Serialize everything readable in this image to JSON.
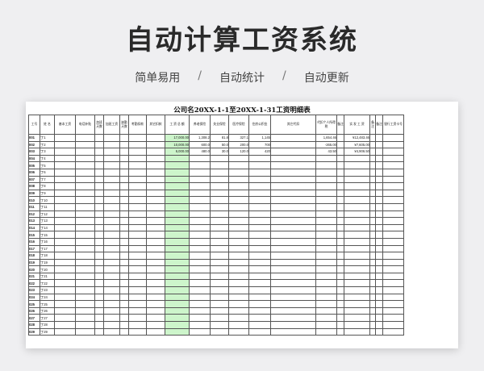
{
  "hero": {
    "title": "自动计算工资系统",
    "features": [
      "简单易用",
      "自动统计",
      "自动更新"
    ],
    "separator": "/"
  },
  "sheet": {
    "title": "公司名20XX-1-1至20XX-1-31工资明细表",
    "highlight_color": "#cdf5cb",
    "columns": [
      "工号",
      "姓 名",
      "基本工资",
      "电话补贴",
      "加班天数",
      "加班工资",
      "缺勤天数",
      "考勤扣款",
      "其它扣款",
      "工 资 总 额",
      "养老保险",
      "失业保险",
      "医疗保险",
      "住房公积金",
      "其它代扣",
      "代扣个人所得税",
      "备注",
      "实 发 工 资",
      "备注",
      "备注",
      "银行工资卡号"
    ],
    "rows": [
      [
        "001",
        "丁1",
        "",
        "",
        "",
        "",
        "",
        "",
        "",
        "17,000.00",
        "1,308.2",
        "81.8",
        "327.1",
        "1,145",
        "",
        "1,654.46",
        "",
        "¥12,483.46",
        "",
        "",
        ""
      ],
      [
        "002",
        "丁2",
        "",
        "",
        "",
        "",
        "",
        "",
        "",
        "10,000.00",
        "600.0",
        "50.0",
        "200.0",
        "700",
        "",
        "-265.00",
        "",
        "¥7,605.00",
        "",
        "",
        ""
      ],
      [
        "003",
        "丁3",
        "",
        "",
        "",
        "",
        "",
        "",
        "",
        "6,000.00",
        "480.0",
        "30.0",
        "120.0",
        "420",
        "",
        "43.50",
        "",
        "¥4,906.50",
        "",
        "",
        ""
      ],
      [
        "004",
        "丁4"
      ],
      [
        "005",
        "丁5"
      ],
      [
        "006",
        "丁6"
      ],
      [
        "007",
        "丁7"
      ],
      [
        "008",
        "丁8"
      ],
      [
        "009",
        "丁9"
      ],
      [
        "010",
        "丁10"
      ],
      [
        "011",
        "丁11"
      ],
      [
        "012",
        "丁12"
      ],
      [
        "013",
        "丁13"
      ],
      [
        "014",
        "丁14"
      ],
      [
        "015",
        "丁15"
      ],
      [
        "016",
        "丁16"
      ],
      [
        "017",
        "丁17"
      ],
      [
        "018",
        "丁18"
      ],
      [
        "019",
        "丁19"
      ],
      [
        "020",
        "丁20"
      ],
      [
        "021",
        "丁21"
      ],
      [
        "022",
        "丁22"
      ],
      [
        "023",
        "丁23"
      ],
      [
        "024",
        "丁24"
      ],
      [
        "025",
        "丁25"
      ],
      [
        "026",
        "丁26"
      ],
      [
        "027",
        "丁27"
      ],
      [
        "028",
        "丁28"
      ],
      [
        "029",
        "丁29"
      ]
    ]
  }
}
